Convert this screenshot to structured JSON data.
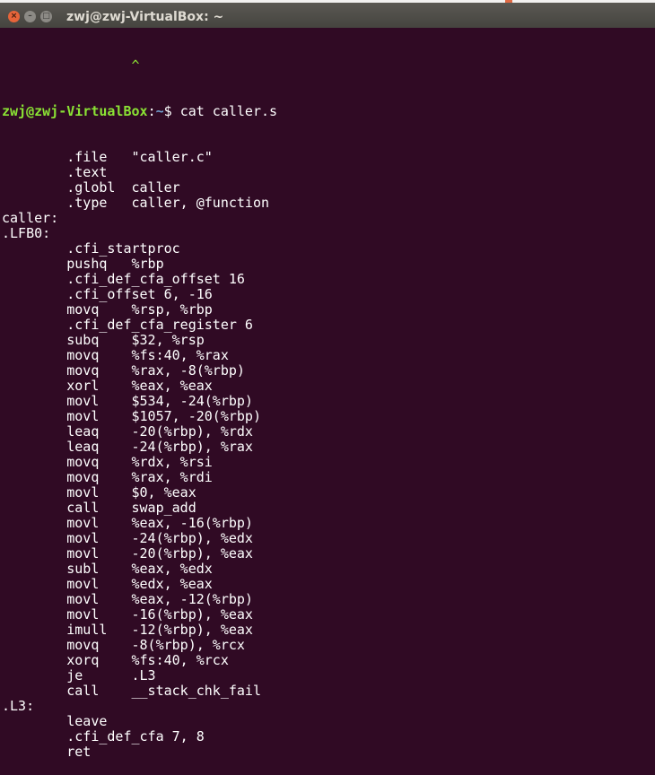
{
  "window": {
    "title": "zwj@zwj-VirtualBox: ~",
    "background": "#300a24"
  },
  "prompt": {
    "user_host": "zwj@zwj-VirtualBox",
    "sep": ":",
    "path": "~",
    "symbol": "$ ",
    "command": "cat caller.s",
    "color": "#8ae234",
    "path_color": "#729fcf"
  },
  "above_line": "                ^",
  "output": [
    "        .file   \"caller.c\"",
    "        .text",
    "        .globl  caller",
    "        .type   caller, @function",
    "caller:",
    ".LFB0:",
    "        .cfi_startproc",
    "        pushq   %rbp",
    "        .cfi_def_cfa_offset 16",
    "        .cfi_offset 6, -16",
    "        movq    %rsp, %rbp",
    "        .cfi_def_cfa_register 6",
    "        subq    $32, %rsp",
    "        movq    %fs:40, %rax",
    "        movq    %rax, -8(%rbp)",
    "        xorl    %eax, %eax",
    "        movl    $534, -24(%rbp)",
    "        movl    $1057, -20(%rbp)",
    "        leaq    -20(%rbp), %rdx",
    "        leaq    -24(%rbp), %rax",
    "        movq    %rdx, %rsi",
    "        movq    %rax, %rdi",
    "        movl    $0, %eax",
    "        call    swap_add",
    "        movl    %eax, -16(%rbp)",
    "        movl    -24(%rbp), %edx",
    "        movl    -20(%rbp), %eax",
    "        subl    %eax, %edx",
    "        movl    %edx, %eax",
    "        movl    %eax, -12(%rbp)",
    "        movl    -16(%rbp), %eax",
    "        imull   -12(%rbp), %eax",
    "        movq    -8(%rbp), %rcx",
    "        xorq    %fs:40, %rcx",
    "        je      .L3",
    "        call    __stack_chk_fail",
    ".L3:",
    "        leave",
    "        .cfi_def_cfa 7, 8",
    "        ret"
  ]
}
